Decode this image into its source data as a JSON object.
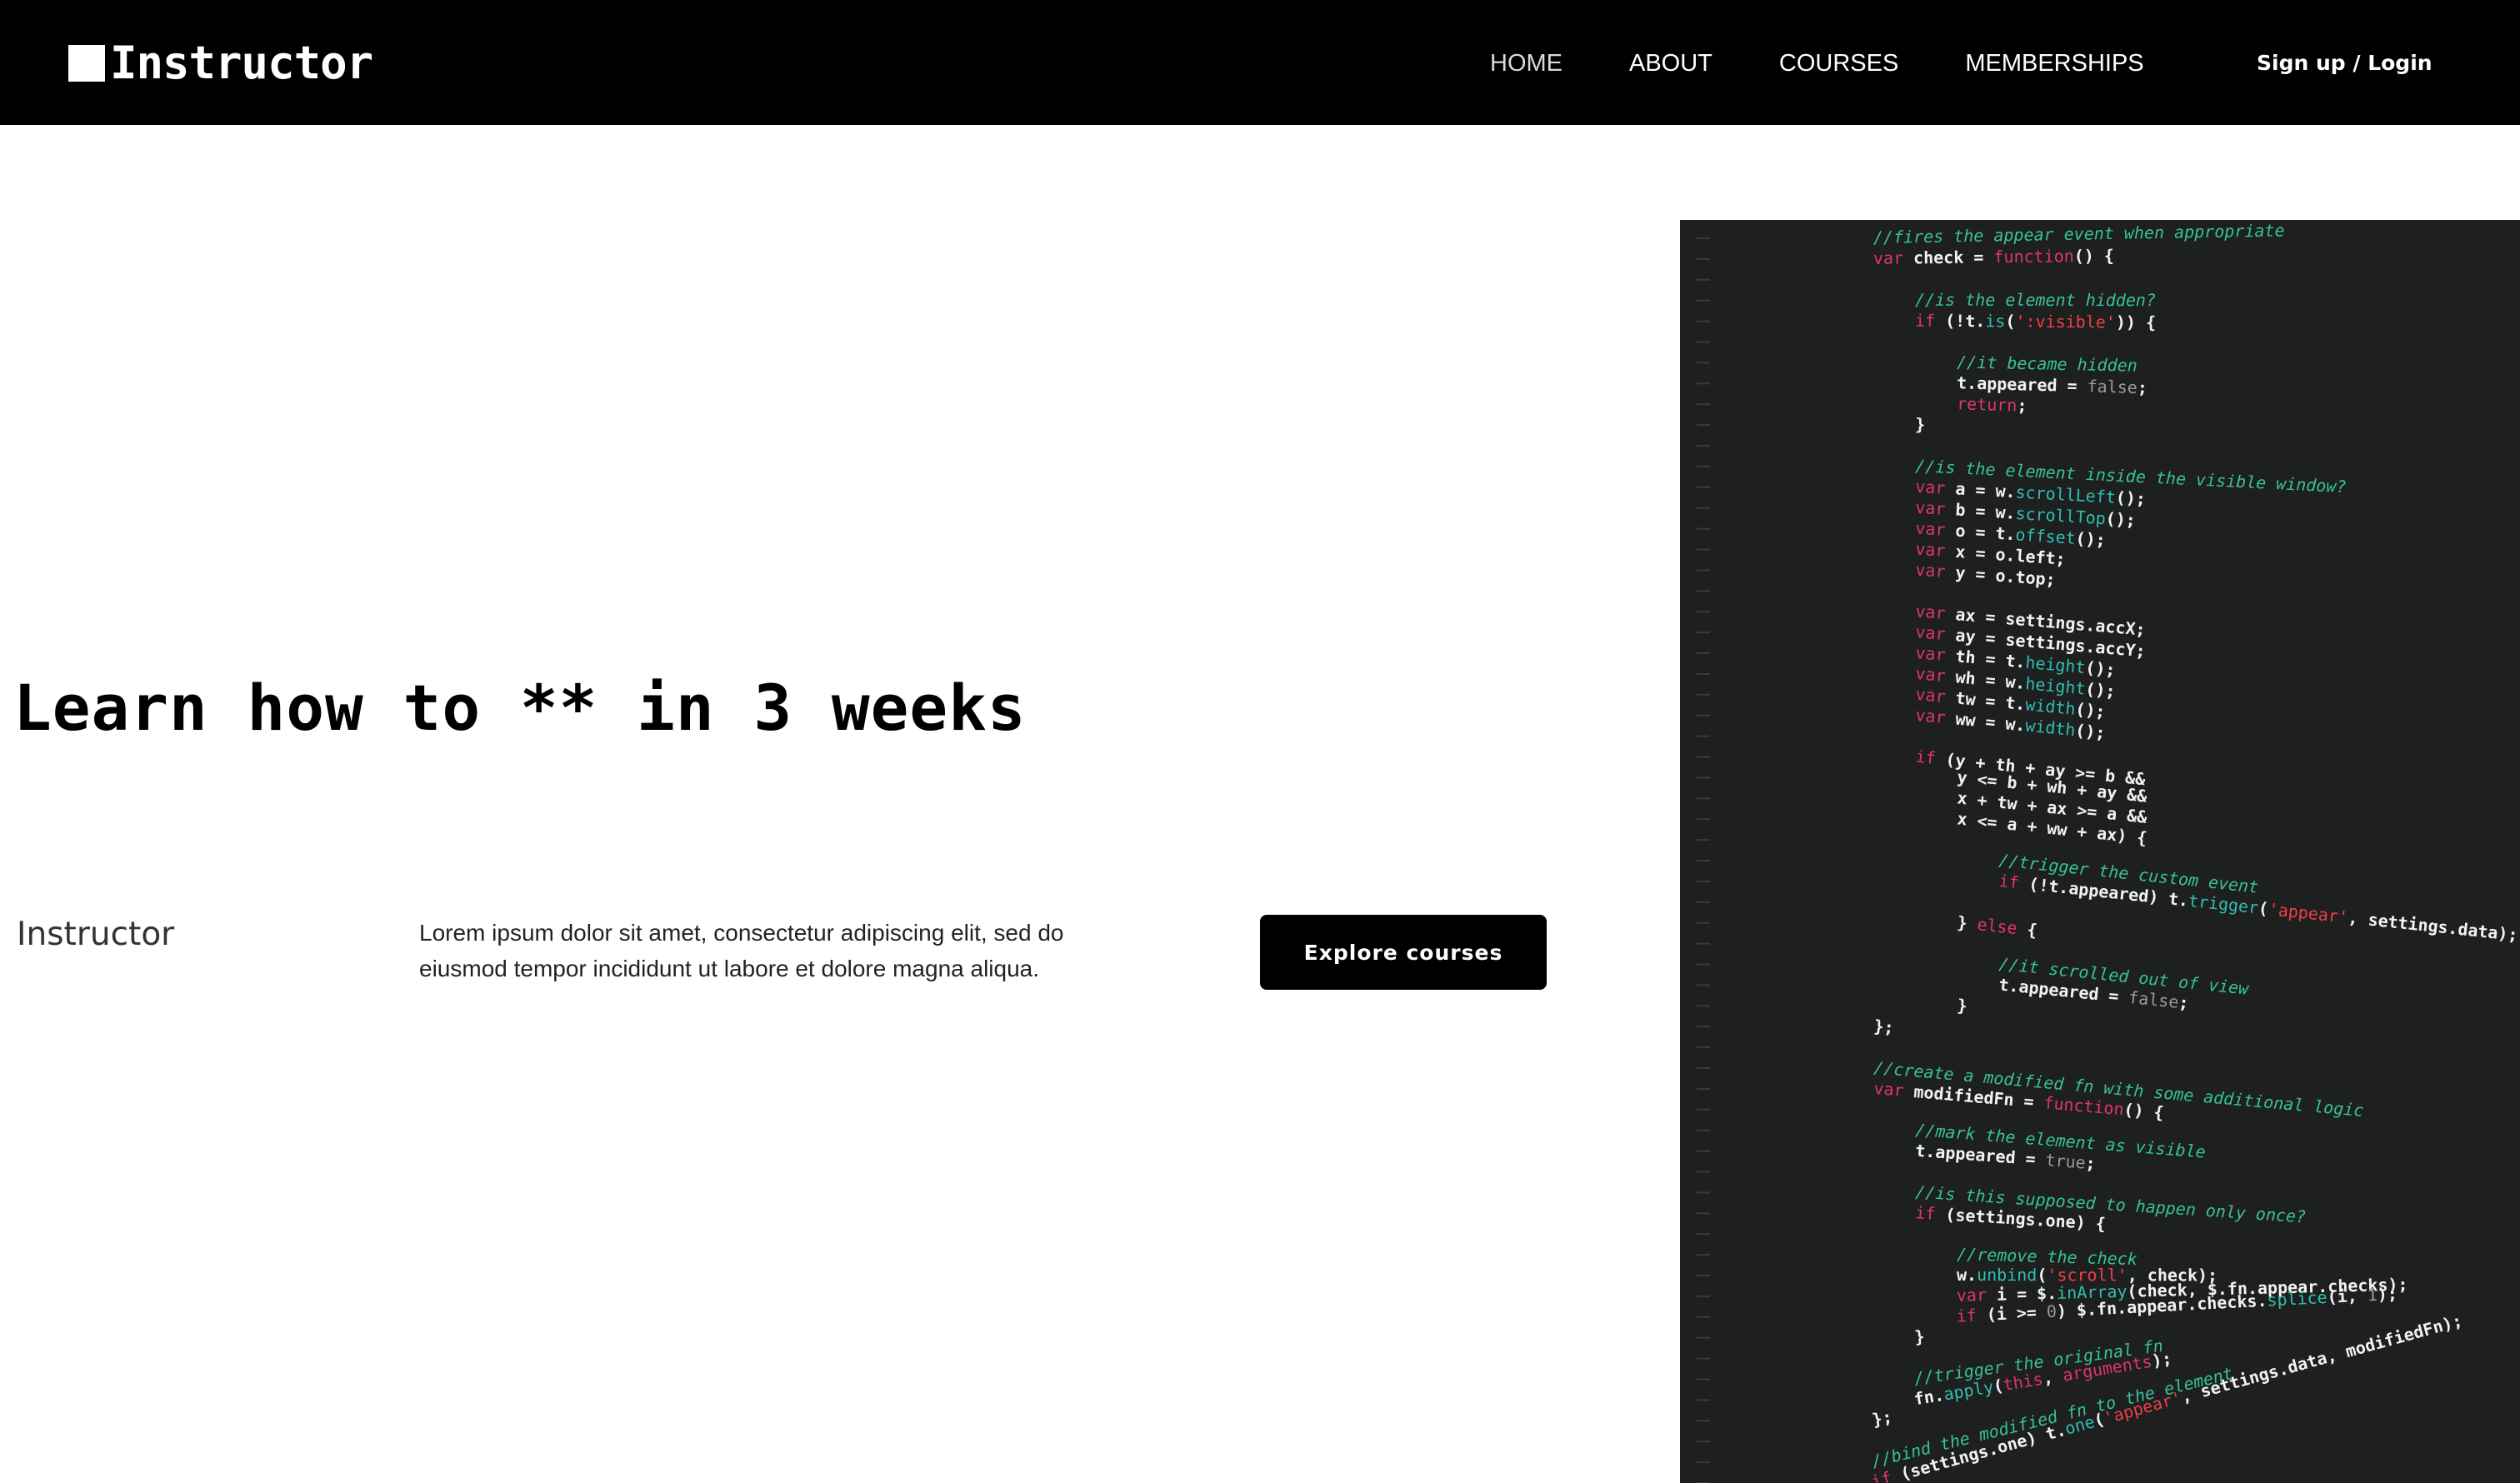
{
  "header": {
    "logo_text": "Instructor",
    "nav": [
      {
        "label": "HOME",
        "active": true
      },
      {
        "label": "ABOUT",
        "active": false
      },
      {
        "label": "COURSES",
        "active": false
      },
      {
        "label": "MEMBERSHIPS",
        "active": false
      }
    ],
    "signup_label": "Sign up / Login"
  },
  "hero": {
    "title": "Learn how to ** in 3 weeks",
    "instructor": "Instructor",
    "description": "Lorem ipsum dolor sit amet, consectetur adipiscing elit, sed do eiusmod tempor incididunt ut labore et dolore magna aliqua.",
    "cta_label": "Explore courses"
  },
  "code_image": {
    "lines": [
      {
        "indent": 0,
        "parts": [
          [
            "//fires the appear event when appropriate",
            "c"
          ]
        ]
      },
      {
        "indent": 0,
        "parts": [
          [
            "var ",
            "k"
          ],
          [
            "check = ",
            "w"
          ],
          [
            "function",
            "k"
          ],
          [
            "() {",
            "w"
          ]
        ]
      },
      {
        "indent": 0,
        "parts": []
      },
      {
        "indent": 1,
        "parts": [
          [
            "//is the element hidden?",
            "c"
          ]
        ]
      },
      {
        "indent": 1,
        "parts": [
          [
            "if ",
            "k"
          ],
          [
            "(!t.",
            "w"
          ],
          [
            "is",
            "f"
          ],
          [
            "(",
            "w"
          ],
          [
            "':visible'",
            "s"
          ],
          [
            ")) {",
            "w"
          ]
        ]
      },
      {
        "indent": 0,
        "parts": []
      },
      {
        "indent": 2,
        "parts": [
          [
            "//it became hidden",
            "c"
          ]
        ]
      },
      {
        "indent": 2,
        "parts": [
          [
            "t.appeared = ",
            "w"
          ],
          [
            "false",
            "g"
          ],
          [
            ";",
            "w"
          ]
        ]
      },
      {
        "indent": 2,
        "parts": [
          [
            "return",
            "k"
          ],
          [
            ";",
            "w"
          ]
        ]
      },
      {
        "indent": 1,
        "parts": [
          [
            "}",
            "w"
          ]
        ]
      },
      {
        "indent": 0,
        "parts": []
      },
      {
        "indent": 1,
        "parts": [
          [
            "//is the element inside the visible window?",
            "c"
          ]
        ]
      },
      {
        "indent": 1,
        "parts": [
          [
            "var ",
            "k"
          ],
          [
            "a = w.",
            "w"
          ],
          [
            "scrollLeft",
            "f"
          ],
          [
            "();",
            "w"
          ]
        ]
      },
      {
        "indent": 1,
        "parts": [
          [
            "var ",
            "k"
          ],
          [
            "b = w.",
            "w"
          ],
          [
            "scrollTop",
            "f"
          ],
          [
            "();",
            "w"
          ]
        ]
      },
      {
        "indent": 1,
        "parts": [
          [
            "var ",
            "k"
          ],
          [
            "o = t.",
            "w"
          ],
          [
            "offset",
            "f"
          ],
          [
            "();",
            "w"
          ]
        ]
      },
      {
        "indent": 1,
        "parts": [
          [
            "var ",
            "k"
          ],
          [
            "x = o.left;",
            "w"
          ]
        ]
      },
      {
        "indent": 1,
        "parts": [
          [
            "var ",
            "k"
          ],
          [
            "y = o.top;",
            "w"
          ]
        ]
      },
      {
        "indent": 0,
        "parts": []
      },
      {
        "indent": 1,
        "parts": [
          [
            "var ",
            "k"
          ],
          [
            "ax = settings.accX;",
            "w"
          ]
        ]
      },
      {
        "indent": 1,
        "parts": [
          [
            "var ",
            "k"
          ],
          [
            "ay = settings.accY;",
            "w"
          ]
        ]
      },
      {
        "indent": 1,
        "parts": [
          [
            "var ",
            "k"
          ],
          [
            "th = t.",
            "w"
          ],
          [
            "height",
            "f"
          ],
          [
            "();",
            "w"
          ]
        ]
      },
      {
        "indent": 1,
        "parts": [
          [
            "var ",
            "k"
          ],
          [
            "wh = w.",
            "w"
          ],
          [
            "height",
            "f"
          ],
          [
            "();",
            "w"
          ]
        ]
      },
      {
        "indent": 1,
        "parts": [
          [
            "var ",
            "k"
          ],
          [
            "tw = t.",
            "w"
          ],
          [
            "width",
            "f"
          ],
          [
            "();",
            "w"
          ]
        ]
      },
      {
        "indent": 1,
        "parts": [
          [
            "var ",
            "k"
          ],
          [
            "ww = w.",
            "w"
          ],
          [
            "width",
            "f"
          ],
          [
            "();",
            "w"
          ]
        ]
      },
      {
        "indent": 0,
        "parts": []
      },
      {
        "indent": 1,
        "parts": [
          [
            "if ",
            "k"
          ],
          [
            "(y + th + ay >= b &&",
            "w"
          ]
        ]
      },
      {
        "indent": 2,
        "parts": [
          [
            "y <= b + wh + ay &&",
            "w"
          ]
        ]
      },
      {
        "indent": 2,
        "parts": [
          [
            "x + tw + ax >= a &&",
            "w"
          ]
        ]
      },
      {
        "indent": 2,
        "parts": [
          [
            "x <= a + ww + ax) {",
            "w"
          ]
        ]
      },
      {
        "indent": 0,
        "parts": []
      },
      {
        "indent": 3,
        "parts": [
          [
            "//trigger the custom event",
            "c"
          ]
        ]
      },
      {
        "indent": 3,
        "parts": [
          [
            "if ",
            "k"
          ],
          [
            "(!t.appeared) t.",
            "w"
          ],
          [
            "trigger",
            "f"
          ],
          [
            "(",
            "w"
          ],
          [
            "'appear'",
            "s"
          ],
          [
            ", settings.data);",
            "w"
          ]
        ]
      },
      {
        "indent": 0,
        "parts": []
      },
      {
        "indent": 2,
        "parts": [
          [
            "} ",
            "w"
          ],
          [
            "else",
            "k"
          ],
          [
            " {",
            "w"
          ]
        ]
      },
      {
        "indent": 0,
        "parts": []
      },
      {
        "indent": 3,
        "parts": [
          [
            "//it scrolled out of view",
            "c"
          ]
        ]
      },
      {
        "indent": 3,
        "parts": [
          [
            "t.appeared = ",
            "w"
          ],
          [
            "false",
            "g"
          ],
          [
            ";",
            "w"
          ]
        ]
      },
      {
        "indent": 2,
        "parts": [
          [
            "}",
            "w"
          ]
        ]
      },
      {
        "indent": 0,
        "parts": [
          [
            "};",
            "w"
          ]
        ]
      },
      {
        "indent": 0,
        "parts": []
      },
      {
        "indent": 0,
        "parts": [
          [
            "//create a modified fn with some additional logic",
            "c"
          ]
        ]
      },
      {
        "indent": 0,
        "parts": [
          [
            "var ",
            "k"
          ],
          [
            "modifiedFn = ",
            "w"
          ],
          [
            "function",
            "k"
          ],
          [
            "() {",
            "w"
          ]
        ]
      },
      {
        "indent": 0,
        "parts": []
      },
      {
        "indent": 1,
        "parts": [
          [
            "//mark the element as visible",
            "c"
          ]
        ]
      },
      {
        "indent": 1,
        "parts": [
          [
            "t.appeared = ",
            "w"
          ],
          [
            "true",
            "g"
          ],
          [
            ";",
            "w"
          ]
        ]
      },
      {
        "indent": 0,
        "parts": []
      },
      {
        "indent": 1,
        "parts": [
          [
            "//is this supposed to happen only once?",
            "c"
          ]
        ]
      },
      {
        "indent": 1,
        "parts": [
          [
            "if ",
            "k"
          ],
          [
            "(settings.one) {",
            "w"
          ]
        ]
      },
      {
        "indent": 0,
        "parts": []
      },
      {
        "indent": 2,
        "parts": [
          [
            "//remove the check",
            "c"
          ]
        ]
      },
      {
        "indent": 2,
        "parts": [
          [
            "w.",
            "w"
          ],
          [
            "unbind",
            "f"
          ],
          [
            "(",
            "w"
          ],
          [
            "'scroll'",
            "s"
          ],
          [
            ", check);",
            "w"
          ]
        ]
      },
      {
        "indent": 2,
        "parts": [
          [
            "var ",
            "k"
          ],
          [
            "i = $.",
            "w"
          ],
          [
            "inArray",
            "f"
          ],
          [
            "(check, $.fn.appear.checks);",
            "w"
          ]
        ]
      },
      {
        "indent": 2,
        "parts": [
          [
            "if ",
            "k"
          ],
          [
            "(i >= ",
            "w"
          ],
          [
            "0",
            "g"
          ],
          [
            ") $.fn.appear.checks.",
            "w"
          ],
          [
            "splice",
            "f"
          ],
          [
            "(i, ",
            "w"
          ],
          [
            "1",
            "g"
          ],
          [
            ");",
            "w"
          ]
        ]
      },
      {
        "indent": 1,
        "parts": [
          [
            "}",
            "w"
          ]
        ]
      },
      {
        "indent": 0,
        "parts": []
      },
      {
        "indent": 1,
        "parts": [
          [
            "//trigger the original fn",
            "c"
          ]
        ]
      },
      {
        "indent": 1,
        "parts": [
          [
            "fn.",
            "w"
          ],
          [
            "apply",
            "f"
          ],
          [
            "(",
            "w"
          ],
          [
            "this",
            "k"
          ],
          [
            ", ",
            "w"
          ],
          [
            "arguments",
            "k"
          ],
          [
            ");",
            "w"
          ]
        ]
      },
      {
        "indent": 0,
        "parts": [
          [
            "};",
            "w"
          ]
        ]
      },
      {
        "indent": 0,
        "parts": []
      },
      {
        "indent": 0,
        "parts": [
          [
            "//bind the modified fn to the element",
            "c"
          ]
        ]
      },
      {
        "indent": 0,
        "parts": [
          [
            "if ",
            "k"
          ],
          [
            "(settings.one) t.",
            "w"
          ],
          [
            "one",
            "f"
          ],
          [
            "(",
            "w"
          ],
          [
            "'appear'",
            "s"
          ],
          [
            ", settings.data, modifiedFn);",
            "w"
          ]
        ]
      }
    ],
    "colors": {
      "background": "#1e1f1f",
      "comment": "#36c29c",
      "keyword": "#e0356e",
      "function": "#2fbfb0",
      "string": "#ef3f46",
      "text": "#f2f2f2",
      "literal": "#9a9a9a"
    }
  }
}
